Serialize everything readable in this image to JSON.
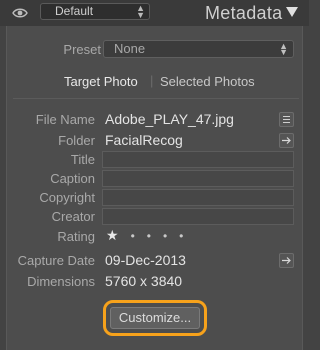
{
  "header": {
    "preset_menu": "Default",
    "title": "Metadata"
  },
  "preset": {
    "label": "Preset",
    "value": "None"
  },
  "tabs": {
    "target": "Target Photo",
    "separator": "|",
    "selected": "Selected Photos"
  },
  "fields": {
    "file_name": {
      "label": "File Name",
      "value": "Adobe_PLAY_47.jpg"
    },
    "folder": {
      "label": "Folder",
      "value": "FacialRecog"
    },
    "title": {
      "label": "Title",
      "value": ""
    },
    "caption": {
      "label": "Caption",
      "value": ""
    },
    "copyright": {
      "label": "Copyright",
      "value": ""
    },
    "creator": {
      "label": "Creator",
      "value": ""
    },
    "rating": {
      "label": "Rating",
      "stars": "★",
      "rating_value": 1,
      "max": 5
    },
    "capture_date": {
      "label": "Capture Date",
      "value": "09-Dec-2013"
    },
    "dimensions": {
      "label": "Dimensions",
      "value": "5760 x 3840"
    }
  },
  "customize_button": "Customize...",
  "colors": {
    "highlight": "#f7a21b",
    "panel": "#4d4d4d",
    "background": "#434343"
  },
  "icons": {
    "eye": "eye-icon",
    "collapse": "triangle-down-icon",
    "spinner": "up-down-arrows-icon",
    "list": "list-icon",
    "go_to": "arrow-right-icon"
  }
}
